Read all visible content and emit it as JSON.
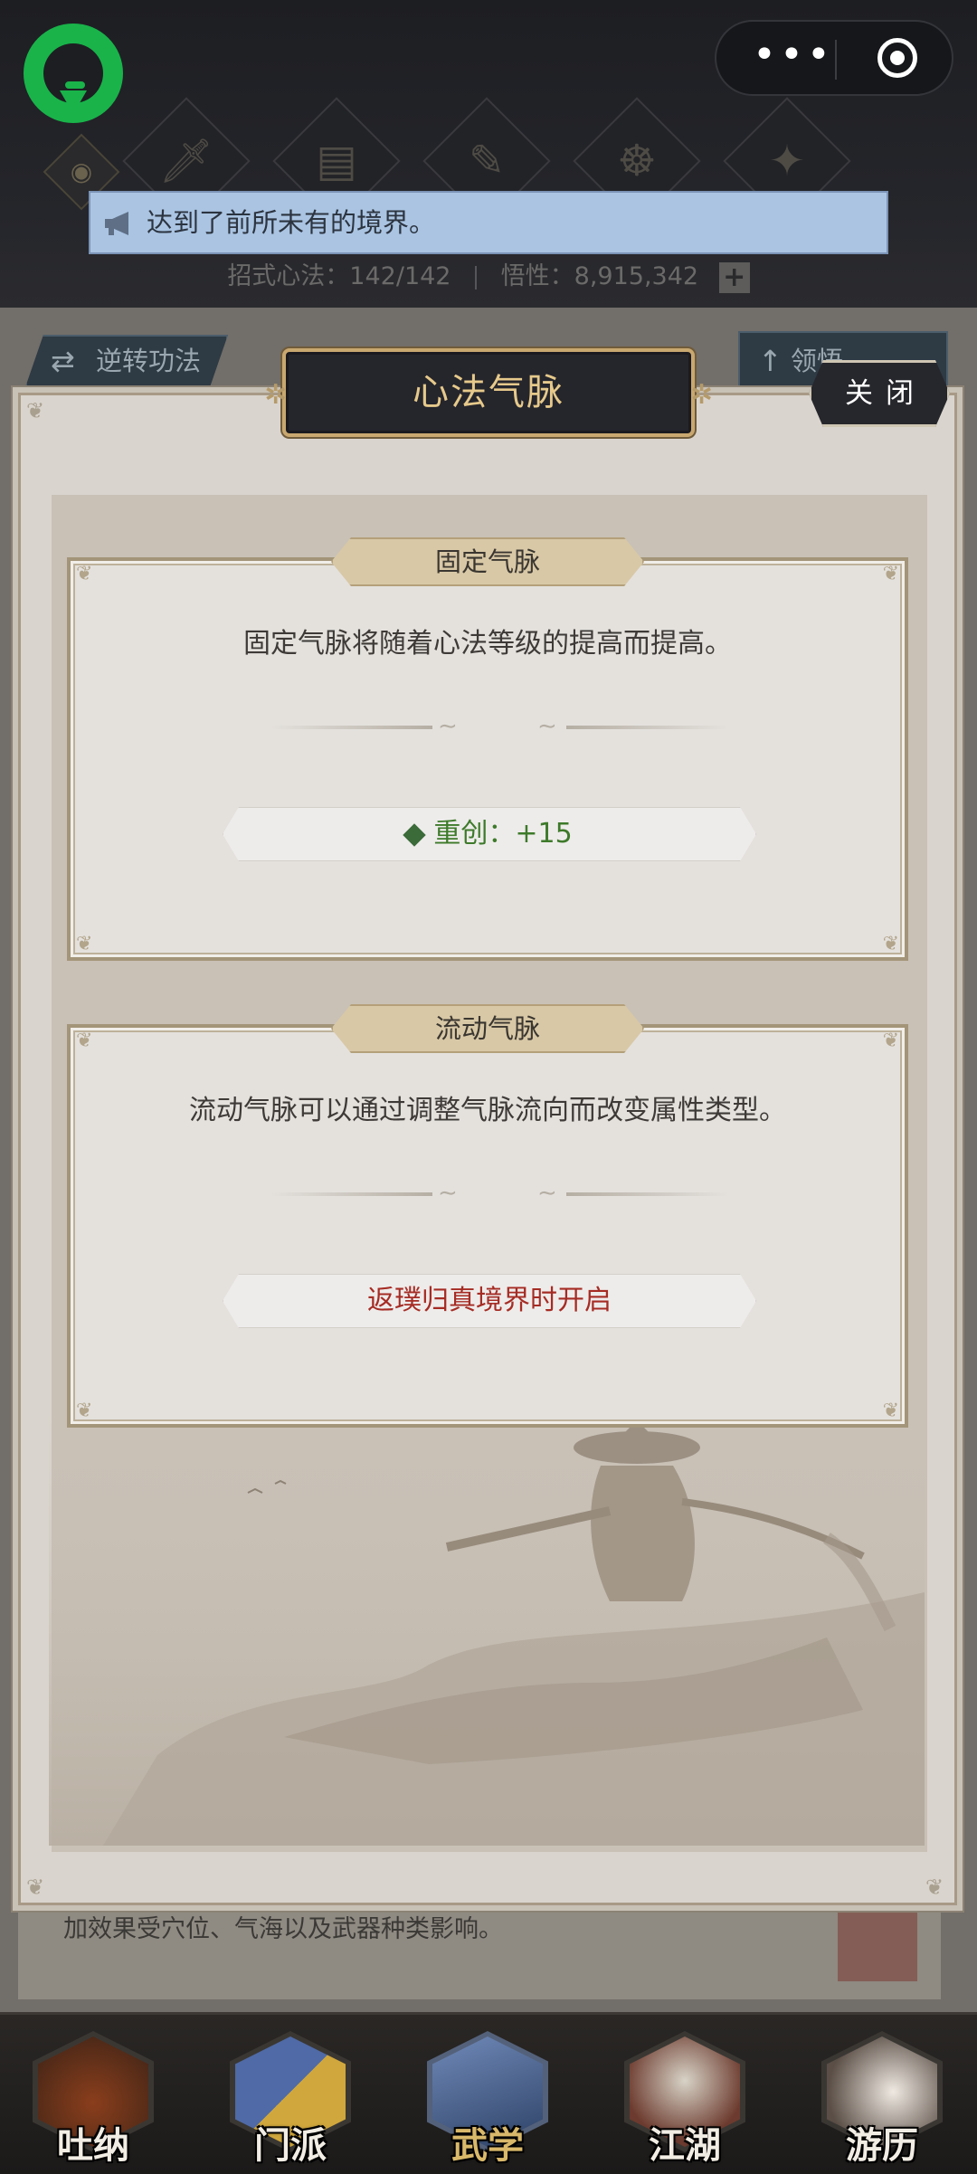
{
  "header": {
    "notice_text": "达到了前所未有的境界。",
    "stats_moves_label": "招式心法：142/142",
    "stats_insight_label": "悟性：8,915,342",
    "plus_label": "+"
  },
  "capsule": {
    "more_label": "•••"
  },
  "background": {
    "reverse_button_label": "逆转功法",
    "comprehend_button_label": "领悟",
    "description_text": "加效果受穴位、气海以及武器种类影响。"
  },
  "modal": {
    "title": "心法气脉",
    "close_label": "关闭",
    "fixed": {
      "tab_label": "固定气脉",
      "description": "固定气脉将随着心法等级的提高而提高。",
      "value_text": "重创：+15"
    },
    "flow": {
      "tab_label": "流动气脉",
      "description": "流动气脉可以通过调整气脉流向而改变属性类型。",
      "locked_text": "返璞归真境界时开启"
    }
  },
  "bottom_nav": {
    "items": [
      {
        "label": "吐纳"
      },
      {
        "label": "门派"
      },
      {
        "label": "武学"
      },
      {
        "label": "江湖"
      },
      {
        "label": "游历"
      }
    ],
    "active_index": 2
  },
  "colors": {
    "accent_gold": "#e6c98b",
    "value_green": "#3d7a2a",
    "locked_red": "#a52c24",
    "notice_blue": "#aac4e2"
  }
}
